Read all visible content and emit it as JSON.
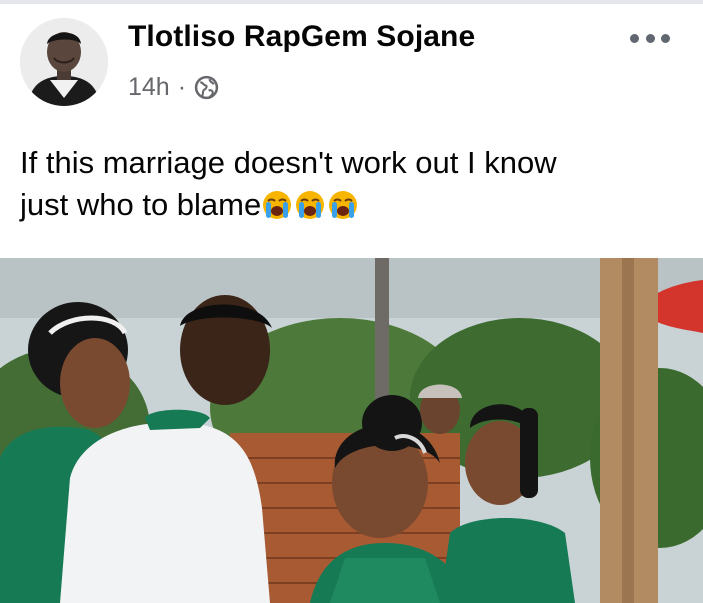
{
  "post": {
    "author": "Tlotliso RapGem Sojane",
    "timestamp": "14h",
    "separator": "·",
    "privacy_icon": "globe-icon",
    "more_icon": "more-options-icon",
    "text_line_1": "If this marriage doesn't work out I know",
    "text_line_2": "just who to blame",
    "emoji": [
      "loudly-crying-face",
      "loudly-crying-face",
      "loudly-crying-face"
    ]
  },
  "colors": {
    "name": "#050505",
    "meta": "#65676b",
    "dots": "#606770",
    "emoji_face": "#f7b500",
    "emoji_tears": "#3aa0e8",
    "dress_green": "#167a55",
    "shirt_white": "#f2f3f5"
  }
}
